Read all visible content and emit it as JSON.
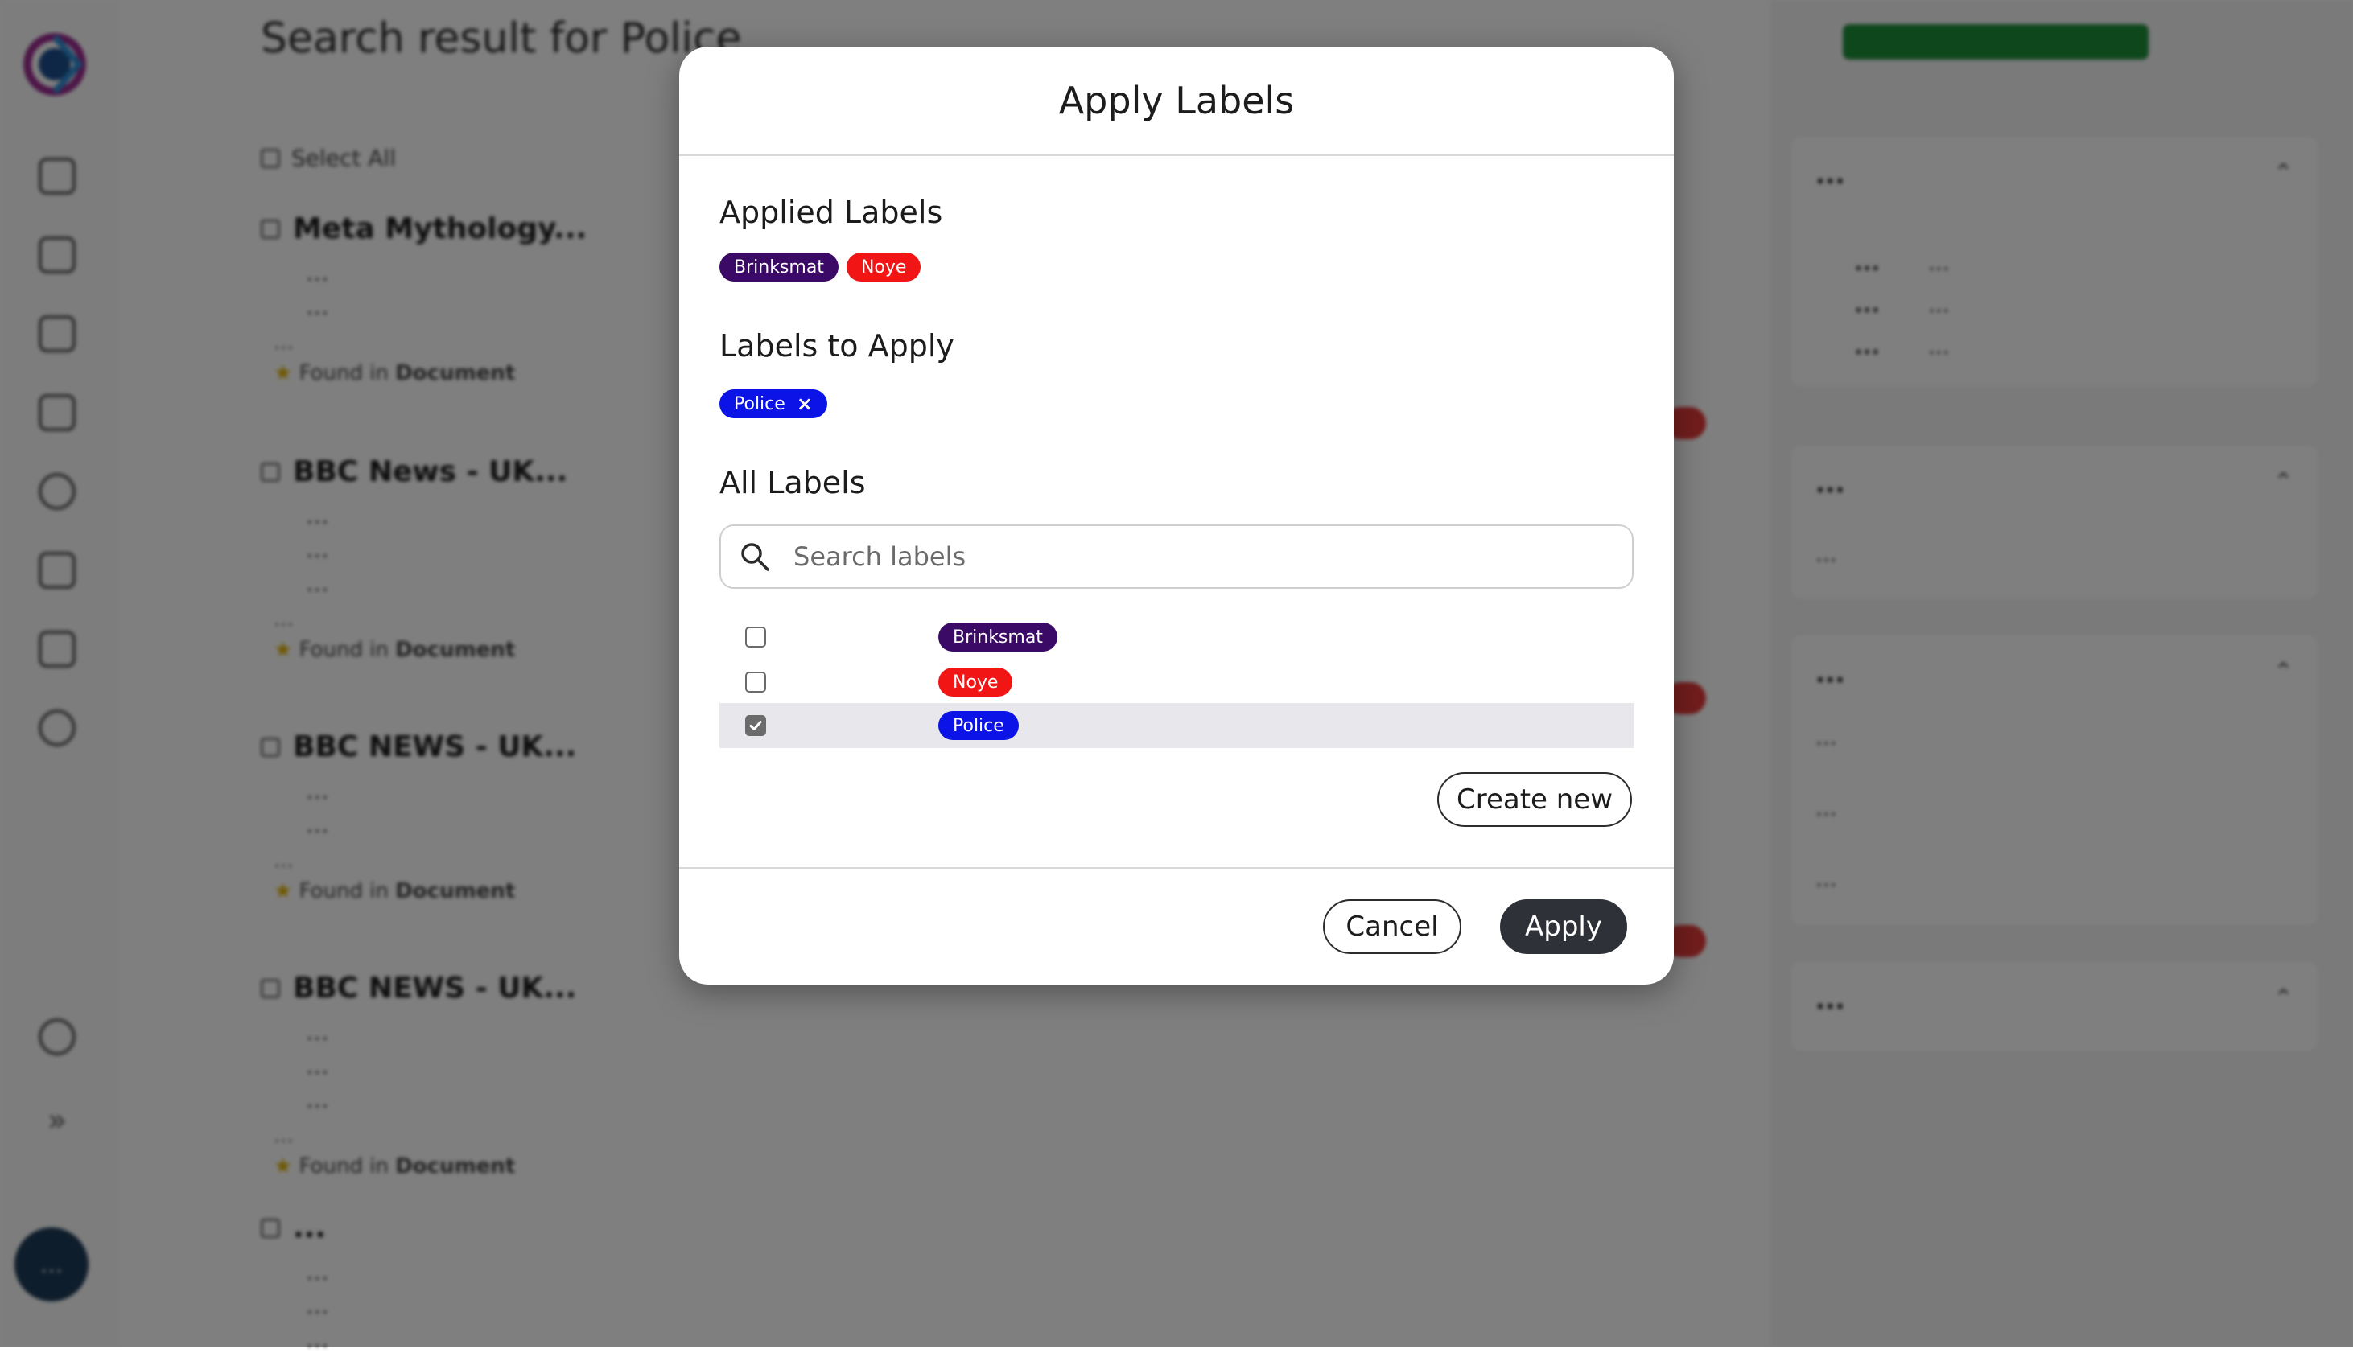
{
  "background": {
    "page_title": "Search result for Police",
    "select_all_label": "Select All",
    "results": [
      {
        "title": "Meta Mythology...",
        "snippet": [
          "...",
          "..."
        ],
        "meta": "...",
        "found_in": "Found in",
        "found_in_link": "Document"
      },
      {
        "title": "BBC News - UK...",
        "snippet": [
          "...",
          "...",
          "..."
        ],
        "meta": "...",
        "found_in": "Found in",
        "found_in_link": "Document"
      },
      {
        "title": "BBC NEWS - UK...",
        "snippet": [
          "...",
          "..."
        ],
        "meta": "...",
        "found_in": "Found in",
        "found_in_link": "Document"
      },
      {
        "title": "BBC NEWS - UK...",
        "snippet": [
          "...",
          "...",
          "..."
        ],
        "meta": "...",
        "found_in": "Found in",
        "found_in_link": "Document"
      },
      {
        "title": "...",
        "snippet": [
          "...",
          "...",
          "..."
        ],
        "meta": "",
        "found_in": "",
        "found_in_link": ""
      }
    ],
    "sidebar": {
      "cards": [
        {
          "title": "...",
          "rows": [
            {
              "num": "...",
              "label": "..."
            },
            {
              "num": "...",
              "label": "..."
            },
            {
              "num": "...",
              "label": "..."
            }
          ]
        },
        {
          "title": "...",
          "rows": [
            {
              "num": "",
              "label": "..."
            }
          ]
        },
        {
          "title": "...",
          "rows": [
            {
              "num": "",
              "label": "..."
            },
            {
              "num": "",
              "label": "..."
            },
            {
              "num": "",
              "label": "..."
            }
          ]
        },
        {
          "title": "...",
          "rows": []
        }
      ]
    },
    "avatar_initials": "..."
  },
  "modal": {
    "title": "Apply Labels",
    "applied_section_title": "Applied Labels",
    "applied_labels": [
      {
        "name": "Brinksmat",
        "color": "#3b0a66"
      },
      {
        "name": "Noye",
        "color": "#f21515"
      }
    ],
    "to_apply_section_title": "Labels to Apply",
    "to_apply_labels": [
      {
        "name": "Police",
        "color": "#0b13e6",
        "remove_icon": "close-icon"
      }
    ],
    "all_section_title": "All Labels",
    "search": {
      "placeholder": "Search labels",
      "value": "",
      "icon": "search-icon"
    },
    "all_labels": [
      {
        "name": "Brinksmat",
        "color": "#3b0a66",
        "checked": false
      },
      {
        "name": "Noye",
        "color": "#f21515",
        "checked": false
      },
      {
        "name": "Police",
        "color": "#0b13e6",
        "checked": true
      }
    ],
    "create_new_label": "Create new",
    "cancel_label": "Cancel",
    "apply_label": "Apply"
  }
}
